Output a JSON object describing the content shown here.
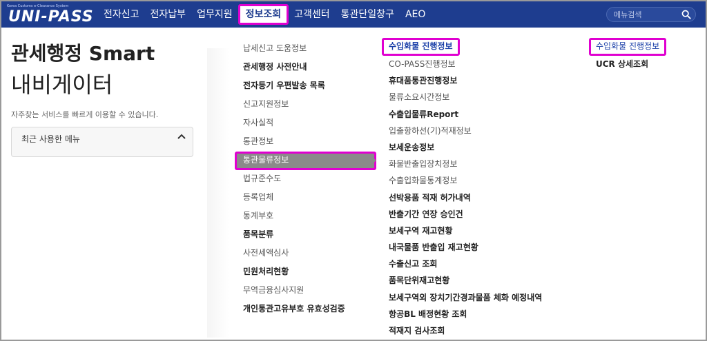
{
  "header": {
    "logo_tiny": "Korea Customs e-Clearance System",
    "logo_text": "UNI-PASS",
    "nav": [
      {
        "label": "전자신고"
      },
      {
        "label": "전자납부"
      },
      {
        "label": "업무지원"
      },
      {
        "label": "정보조회",
        "active": true
      },
      {
        "label": "고객센터"
      },
      {
        "label": "통관단일창구"
      },
      {
        "label": "AEO"
      }
    ],
    "search_placeholder": "메뉴검색",
    "search_icon": "search-icon"
  },
  "left": {
    "title_line1": "관세행정 Smart",
    "title_line2": "내비게이터",
    "subtitle": "자주찾는 서비스를 빠르게 이용할 수 있습니다.",
    "recent_menu_label": "최근 사용한 메뉴",
    "recent_menu_icon": "chevron-up-icon"
  },
  "col1": [
    {
      "label": "납세신고 도움정보",
      "bold": false
    },
    {
      "label": "관세행정 사전안내",
      "bold": true
    },
    {
      "label": "전자등기 우편발송 목록",
      "bold": true
    },
    {
      "label": "신고지원정보",
      "bold": false
    },
    {
      "label": "자사실적",
      "bold": false
    },
    {
      "label": "통관정보",
      "bold": false
    },
    {
      "label": "통관물류정보",
      "bold": false,
      "selected": true
    },
    {
      "label": "법규준수도",
      "bold": false
    },
    {
      "label": "등록업체",
      "bold": false
    },
    {
      "label": "통계부호",
      "bold": false
    },
    {
      "label": "품목분류",
      "bold": true
    },
    {
      "label": "사전세액심사",
      "bold": false
    },
    {
      "label": "민원처리현황",
      "bold": true
    },
    {
      "label": "무역금융심사지원",
      "bold": false
    },
    {
      "label": "개인통관고유부호 유효성검증",
      "bold": true
    }
  ],
  "col2": [
    {
      "label": "수입화물 진행정보",
      "highlight": true
    },
    {
      "label": "CO-PASS진행정보",
      "bold": false
    },
    {
      "label": "휴대품통관진행정보",
      "bold": true
    },
    {
      "label": "물류소요시간정보",
      "bold": false
    },
    {
      "label": "수출입물류Report",
      "bold": true
    },
    {
      "label": "입출항하선(기)적재정보",
      "bold": false
    },
    {
      "label": "보세운송정보",
      "bold": true
    },
    {
      "label": "화물반출입장치정보",
      "bold": false
    },
    {
      "label": "수출입화물통계정보",
      "bold": false
    },
    {
      "label": "선박용품 적재 허가내역",
      "bold": true
    },
    {
      "label": "반출기간 연장 승인건",
      "bold": true
    },
    {
      "label": "보세구역 재고현황",
      "bold": true
    },
    {
      "label": "내국물품 반출입 재고현황",
      "bold": true
    },
    {
      "label": "수출신고 조회",
      "bold": true
    },
    {
      "label": "품목단위재고현황",
      "bold": true
    },
    {
      "label": "보세구역외 장치기간경과물품 체화 예정내역",
      "bold": true
    },
    {
      "label": "항공BL 배정현황 조회",
      "bold": true
    },
    {
      "label": "적재지 검사조회",
      "bold": true
    }
  ],
  "col3": [
    {
      "label": "수입화물 진행정보",
      "highlight": true
    },
    {
      "label": "UCR 상세조회",
      "bold": true
    }
  ],
  "colors": {
    "header_bg": "#1e3d8f",
    "highlight_border": "#e000d0",
    "selected_bg": "#8a8a8a",
    "link_blue": "#1a3fa8"
  }
}
